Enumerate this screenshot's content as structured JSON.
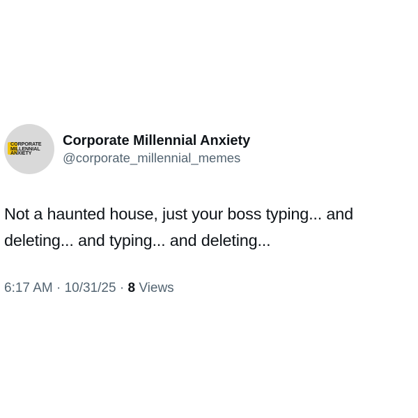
{
  "profile": {
    "avatar_logo_lines": [
      "CORPORATE",
      "MILLENNIAL",
      "ANXIETY"
    ],
    "display_name": "Corporate Millennial Anxiety",
    "handle": "@corporate_millennial_memes"
  },
  "post": {
    "text": "Not a haunted house, just your boss typing... and deleting... and typing... and deleting..."
  },
  "meta": {
    "time": "6:17 AM",
    "separator": " · ",
    "date": "10/31/25",
    "views_count": "8",
    "views_label": " Views"
  },
  "colors": {
    "text_primary": "#0f1419",
    "text_secondary": "#536471",
    "avatar_bg": "#d9d9d9",
    "logo_accent": "#f1c40f"
  }
}
